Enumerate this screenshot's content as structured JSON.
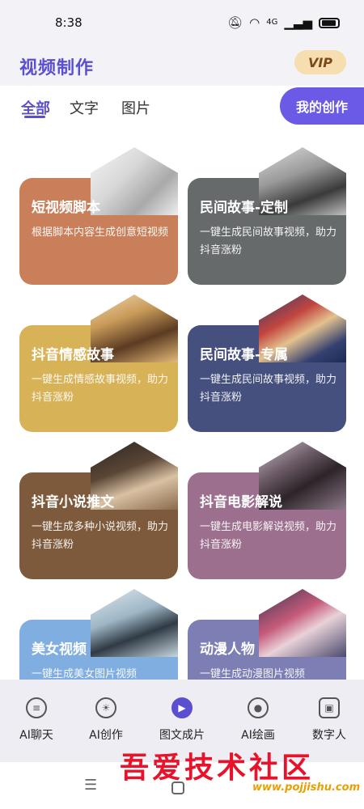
{
  "status_bar": {
    "time": "8:38",
    "signal": "4G"
  },
  "header": {
    "title": "视频制作",
    "vip_label": "VIP"
  },
  "tabs": [
    {
      "label": "全部",
      "active": true
    },
    {
      "label": "文字",
      "active": false
    },
    {
      "label": "图片",
      "active": false
    }
  ],
  "my_creation_label": "我的创作",
  "cards": [
    {
      "title": "短视频脚本",
      "desc": "根据脚本内容生成创意短视频",
      "color": "#c9805a"
    },
    {
      "title": "民间故事-定制",
      "desc": "一键生成民间故事视频，助力抖音涨粉",
      "color": "#676a6b"
    },
    {
      "title": "抖音情感故事",
      "desc": "一键生成情感故事视频，助力抖音涨粉",
      "color": "#d8b256"
    },
    {
      "title": "民间故事-专属",
      "desc": "一键生成民间故事视频，助力抖音涨粉",
      "color": "#46507e"
    },
    {
      "title": "抖音小说推文",
      "desc": "一键生成多种小说视频，助力抖音涨粉",
      "color": "#7d5a3b"
    },
    {
      "title": "抖音电影解说",
      "desc": "一键生成电影解说视频，助力抖音涨粉",
      "color": "#9c6f8e"
    },
    {
      "title": "美女视频",
      "desc": "一键生成美女图片视频",
      "color": "#80aee0"
    },
    {
      "title": "动漫人物",
      "desc": "一键生成动漫图片视频",
      "color": "#7d7fb4"
    }
  ],
  "bottom_nav": [
    {
      "label": "AI聊天",
      "icon": "chat-icon",
      "active": false
    },
    {
      "label": "AI创作",
      "icon": "bulb-icon",
      "active": false
    },
    {
      "label": "图文成片",
      "icon": "video-icon",
      "active": true
    },
    {
      "label": "AI绘画",
      "icon": "palette-icon",
      "active": false
    },
    {
      "label": "数字人",
      "icon": "robot-icon",
      "active": false
    }
  ],
  "watermark": {
    "text": "吾爱技术社区",
    "url": "www.pojjishu.com"
  },
  "colors": {
    "accent": "#5b4fd1",
    "vip_bg": "#f7deb1"
  }
}
